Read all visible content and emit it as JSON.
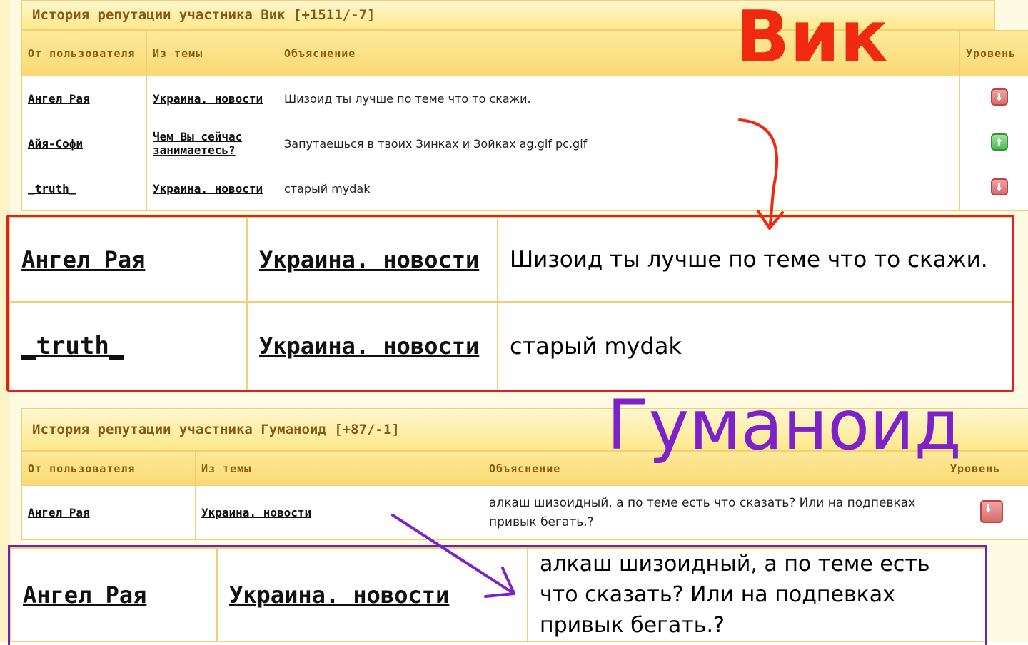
{
  "colors": {
    "vik_label": "#ef2a10",
    "gumanoid_label": "#7d22c8",
    "red_box": "#e02020",
    "purple_box": "#6a25b0",
    "header_text": "#8a5a12",
    "cell_border": "#f1cf7a"
  },
  "section1": {
    "title": "История репутации участника Вик [+1511/-7]",
    "columns": [
      "От пользователя",
      "Из темы",
      "Объяснение",
      "Уровень"
    ],
    "rows": [
      {
        "user": "Ангел Рая",
        "topic": "Украина. новости",
        "explanation": "Шизоид ты лучше по теме что то скажи.",
        "level": "down"
      },
      {
        "user": "Айя-Софи",
        "topic": "Чем Вы сейчас занимаетесь?",
        "explanation": "Запутаешься в твоих Зинках и Зойках ag.gif pc.gif",
        "level": "up"
      },
      {
        "user": "_truth_",
        "topic": "Украина. новости",
        "explanation": "старый mydak",
        "level": "down"
      }
    ],
    "big_label": "Вик"
  },
  "zoom1": {
    "rows": [
      {
        "user": "Ангел Рая",
        "topic": "Украина. новости",
        "explanation": "Шизоид ты лучше по теме что то скажи."
      },
      {
        "user": "_truth_",
        "topic": "Украина. новости",
        "explanation": "старый mydak"
      }
    ]
  },
  "section2": {
    "title": "История репутации участника Гуманоид [+87/-1]",
    "columns": [
      "От пользователя",
      "Из темы",
      "Объяснение",
      "Уровень"
    ],
    "rows": [
      {
        "user": "Ангел Рая",
        "topic": "Украина. новости",
        "explanation": "алкаш шизоидный, а по теме есть что сказать? Или на подпевках привык бегать.?",
        "level": "down"
      }
    ],
    "big_label": "Гуманоид"
  },
  "zoom2": {
    "rows": [
      {
        "user": "Ангел Рая",
        "topic": "Украина. новости",
        "explanation": "алкаш шизоидный, а по теме есть что сказать? Или на подпевках привык бегать.?"
      }
    ]
  },
  "icons": {
    "down": "reputation-down-icon",
    "up": "reputation-up-icon"
  }
}
